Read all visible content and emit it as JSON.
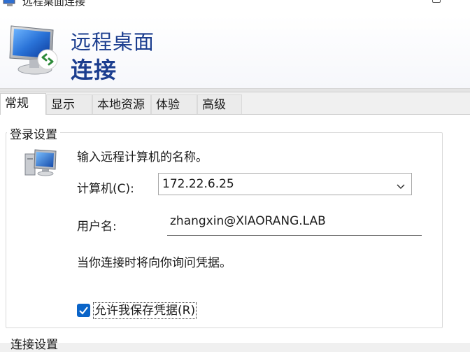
{
  "window": {
    "title": "远程桌面连接"
  },
  "banner": {
    "title_line1": "远程桌面",
    "title_line2": "连接"
  },
  "tabs": [
    {
      "label": "常规",
      "active": true
    },
    {
      "label": "显示",
      "active": false
    },
    {
      "label": "本地资源",
      "active": false
    },
    {
      "label": "体验",
      "active": false
    },
    {
      "label": "高级",
      "active": false
    }
  ],
  "login_settings": {
    "legend": "登录设置",
    "instruction": "输入远程计算机的名称。",
    "computer_label": "计算机(C):",
    "computer_value": "172.22.6.25",
    "username_label": "用户名:",
    "username_value": "zhangxin@XIAORANG.LAB",
    "prompt_note": "当你连接时将向你询问凭据。",
    "save_credentials": {
      "label": "允许我保存凭据(R)",
      "checked": true
    }
  },
  "connection_settings": {
    "legend": "连接设置"
  },
  "colors": {
    "banner_title": "#1c3e8f",
    "checkbox_accent": "#0a64c8"
  }
}
